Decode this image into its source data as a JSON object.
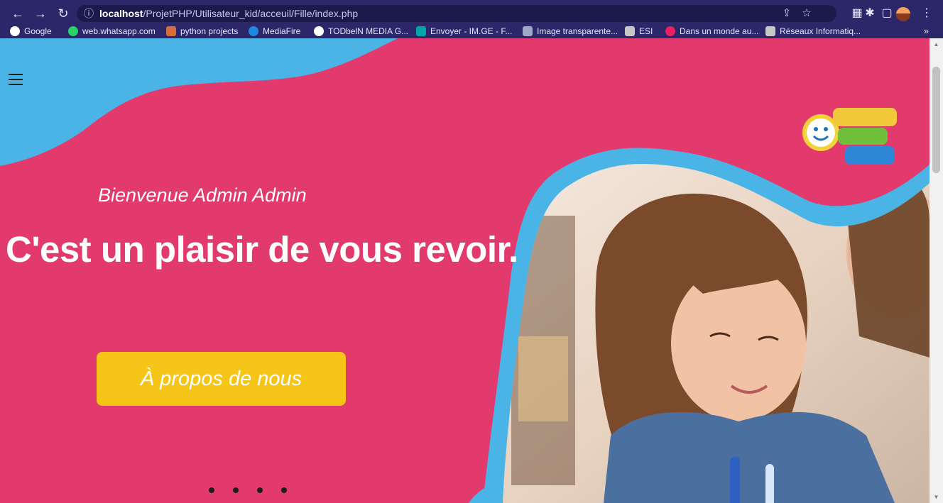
{
  "browser": {
    "url_host": "localhost",
    "url_path": "/ProjetPHP/Utilisateur_kid/acceuil/Fille/index.php",
    "bookmarks": [
      {
        "label": "Google",
        "color": "#ffffff"
      },
      {
        "label": "web.whatsapp.com",
        "color": "#25d366"
      },
      {
        "label": "python projects",
        "color": "#d96b3a"
      },
      {
        "label": "MediaFire",
        "color": "#1e88e5"
      },
      {
        "label": "TODbelN MEDIA G...",
        "color": "#ffffff"
      },
      {
        "label": "Envoyer - IM.GE - F...",
        "color": "#00a6a6"
      },
      {
        "label": "Image transparente...",
        "color": "#9ea7c9"
      },
      {
        "label": "ESI",
        "color": "#c7c7c7"
      },
      {
        "label": "Dans un monde au...",
        "color": "#e91e63"
      },
      {
        "label": "Réseaux Informatiq...",
        "color": "#c7c7c7"
      }
    ],
    "more_label": "»"
  },
  "page": {
    "welcome": "Bienvenue Admin Admin",
    "headline": "C'est un plaisir de vous revoir.",
    "cta_label": "À propos de nous",
    "carousel_dots": 4,
    "colors": {
      "background": "#e33a6d",
      "accent_blue": "#4ab4e6",
      "button_yellow": "#f5c518"
    }
  }
}
